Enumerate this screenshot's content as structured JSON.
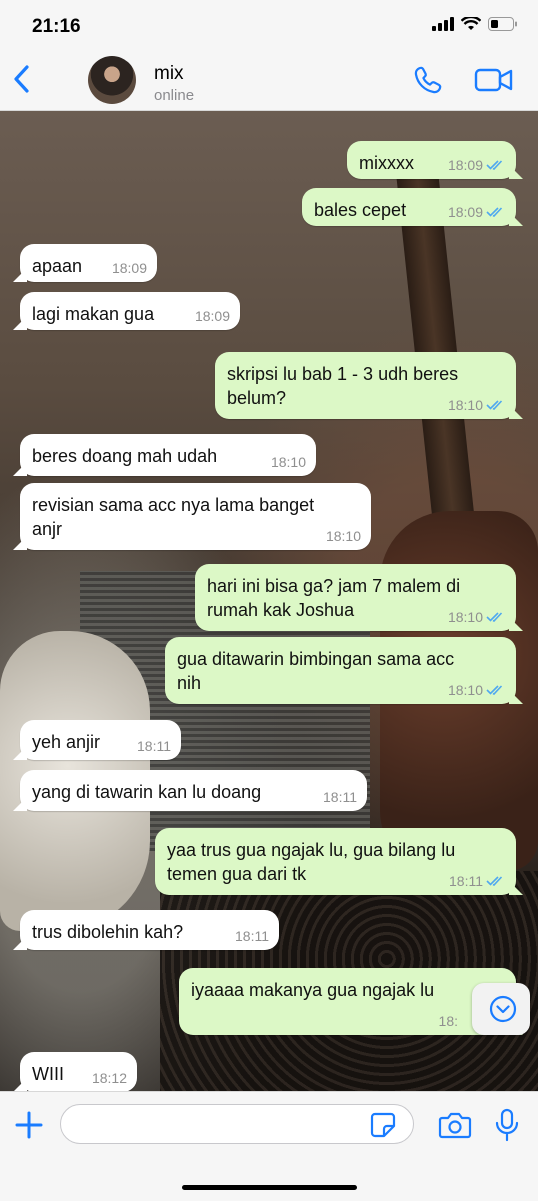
{
  "status_bar": {
    "time": "21:16"
  },
  "header": {
    "contact_name": "mix",
    "contact_status": "online"
  },
  "colors": {
    "accent": "#1a7cff",
    "incoming_bubble": "#ffffff",
    "outgoing_bubble": "#dcf8c6",
    "read_ticks": "#4fa8f0"
  },
  "messages": [
    {
      "dir": "out",
      "lines": [
        "mixxxx"
      ],
      "time": "18:09",
      "read": true
    },
    {
      "dir": "out",
      "lines": [
        "bales cepet"
      ],
      "time": "18:09",
      "read": true
    },
    {
      "dir": "in",
      "lines": [
        "apaan"
      ],
      "time": "18:09"
    },
    {
      "dir": "in",
      "lines": [
        "lagi makan gua"
      ],
      "time": "18:09"
    },
    {
      "dir": "out",
      "lines": [
        "skripsi lu bab 1 - 3 udh beres",
        "belum?"
      ],
      "time": "18:10",
      "read": true
    },
    {
      "dir": "in",
      "lines": [
        "beres doang mah udah"
      ],
      "time": "18:10"
    },
    {
      "dir": "in",
      "lines": [
        "revisian sama acc nya lama banget",
        "anjr"
      ],
      "time": "18:10"
    },
    {
      "dir": "out",
      "lines": [
        "hari ini bisa ga? jam 7 malem di",
        "rumah kak Joshua"
      ],
      "time": "18:10",
      "read": true
    },
    {
      "dir": "out",
      "lines": [
        "gua ditawarin bimbingan sama acc",
        "nih"
      ],
      "time": "18:10",
      "read": true
    },
    {
      "dir": "in",
      "lines": [
        "yeh anjir"
      ],
      "time": "18:11"
    },
    {
      "dir": "in",
      "lines": [
        "yang di tawarin kan lu doang"
      ],
      "time": "18:11"
    },
    {
      "dir": "out",
      "lines": [
        "yaa trus gua ngajak lu, gua bilang lu",
        "temen gua dari tk"
      ],
      "time": "18:11",
      "read": true
    },
    {
      "dir": "in",
      "lines": [
        "trus dibolehin kah?"
      ],
      "time": "18:11"
    },
    {
      "dir": "out",
      "lines": [
        "iyaaaa makanya gua ngajak lu"
      ],
      "time": "18:",
      "read": true
    },
    {
      "dir": "in",
      "lines": [
        "WIII"
      ],
      "time": "18:12"
    }
  ],
  "input": {
    "placeholder": ""
  },
  "icons": {
    "back": "chevron-left-icon",
    "call": "phone-icon",
    "video": "video-camera-icon",
    "plus": "plus-icon",
    "sticker": "sticker-icon",
    "camera": "camera-icon",
    "mic": "microphone-icon",
    "scroll_down": "chevron-down-circle-icon"
  }
}
